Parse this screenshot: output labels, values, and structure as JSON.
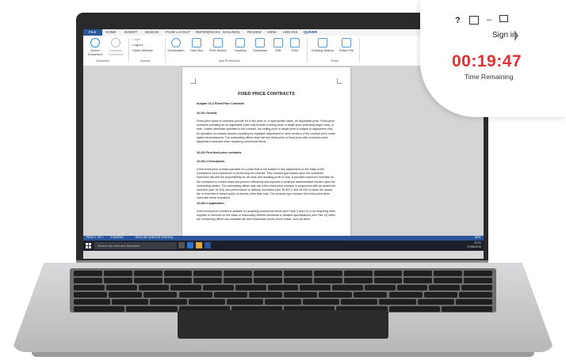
{
  "ribbon": {
    "tabs": [
      "FILE",
      "HOME",
      "INSERT",
      "DESIGN",
      "PAGE LAYOUT",
      "REFERENCES",
      "MAILINGS",
      "REVIEW",
      "VIEW",
      "ADD-INS",
      "QUIVER"
    ],
    "buttons": {
      "quiver_document": "Quiver Document",
      "unquiver_document": "Unquiver Document",
      "login": "Login",
      "logout": "Logout",
      "open_website": "Open Website",
      "geolocation": "Geolocation",
      "time_box": "Time Box",
      "print_screen": "Print Screen",
      "tracking": "Tracking",
      "download": "Download",
      "edit": "Edit",
      "print": "Print",
      "existing_shares": "Existing Shares",
      "share_file": "Share File"
    },
    "groups": {
      "document": "Document",
      "access": "Access",
      "add_protections": "Add Protections",
      "share": "Share"
    }
  },
  "document": {
    "title": "FIXED PRICE CONTRACTS",
    "subpart": "Subpart 16.2-Fixed-Price Contracts",
    "sec1_head": "16.201 General.",
    "sec1_body": "Fixed-price types of contracts provide for a firm price or, in appropriate cases, an adjustable price. Fixed-price contracts providing for an adjustable price may include a ceiling price, a target price (including target cost), or both. Unless otherwise specified in the contract, the ceiling price or target price is subject to adjustment only by operation of contract clauses providing for equitable adjustment or other revision of the contract price under stated circumstances. The contracting officer shall use firm-fixed-price or fixed-price with economic price adjustment contracts when acquiring commercial items.",
    "sec2_head": "16.202 Firm-fixed-price contracts.",
    "sec3_head": "16.202-1 Description.",
    "sec3_body": "A firm-fixed-price contract provides for a price that is not subject to any adjustment on the basis of the contractor's cost experience in performing the contract. This contract type places upon the contractor maximum risk and full responsibility for all costs and resulting profit or loss. It provides maximum incentive for the contractor to control costs and perform effectively and imposes a minimum administrative burden upon the contracting parties. The contracting officer may use a firm-fixed-price contract in conjunction with an award-fee incentive (see 16.404) and performance or delivery incentives (see 16.402-2 and 16.402-3) when the award fee or incentive is based solely on factors other than cost. The contract type remains firm-fixed-price when used with these incentives.",
    "sec4_head": "16.202-2 Application.",
    "sec4_body": "A firm-fixed-price contract is suitable for acquiring commercial items (see Parts 2 and 12) or for acquiring other supplies or services on the basis of reasonably definite functional or detailed specifications (see Part 11) when the contracting officer can establish fair and reasonable prices at the outset, such as when"
  },
  "statusbar": {
    "page": "PAGE 1 OF 1",
    "words": "3 WORDS",
    "language": "ENGLISH (UNITED STATES)",
    "zoom": "80%"
  },
  "taskbar": {
    "search_placeholder": "Search the web and Windows",
    "time": "22:21",
    "date": "27/06/2015"
  },
  "overlay": {
    "help": "?",
    "minimize": "–",
    "sign_in": "Sign in",
    "timer": "00:19:47",
    "timer_label": "Time Remaining",
    "timer_color": "#e03032"
  },
  "colors": {
    "word_blue": "#2b579a",
    "taskbar": "#1d1f2a"
  }
}
